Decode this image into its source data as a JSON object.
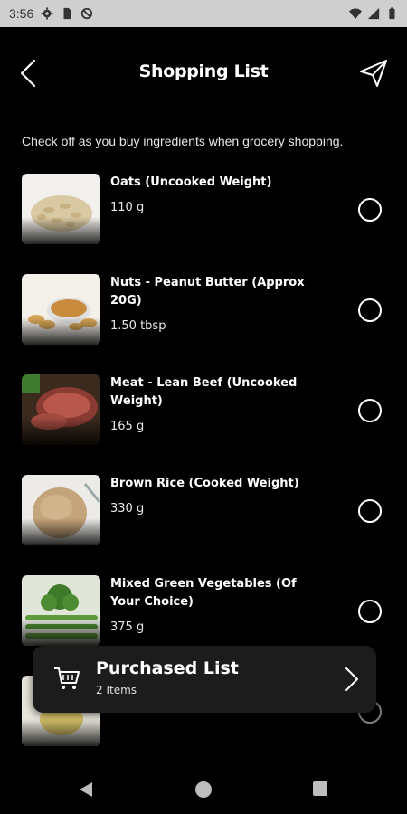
{
  "status_bar": {
    "time": "3:56"
  },
  "header": {
    "title": "Shopping List"
  },
  "subtitle": "Check off as you buy ingredients when grocery shopping.",
  "items": [
    {
      "name": "Oats (Uncooked Weight)",
      "quantity": "110 g",
      "image": "oats"
    },
    {
      "name": "Nuts - Peanut Butter (Approx 20G)",
      "quantity": "1.50 tbsp",
      "image": "peanut-butter"
    },
    {
      "name": "Meat - Lean Beef (Uncooked Weight)",
      "quantity": "165 g",
      "image": "lean-beef"
    },
    {
      "name": "Brown Rice (Cooked Weight)",
      "quantity": "330 g",
      "image": "brown-rice"
    },
    {
      "name": "Mixed Green Vegetables (Of Your Choice)",
      "quantity": "375 g",
      "image": "green-vegetables"
    }
  ],
  "purchased_bar": {
    "title": "Purchased List",
    "count_text": "2 Items"
  },
  "colors": {
    "background": "#000000",
    "card": "#1c1c1c",
    "status_bar": "#cfcfcf"
  }
}
